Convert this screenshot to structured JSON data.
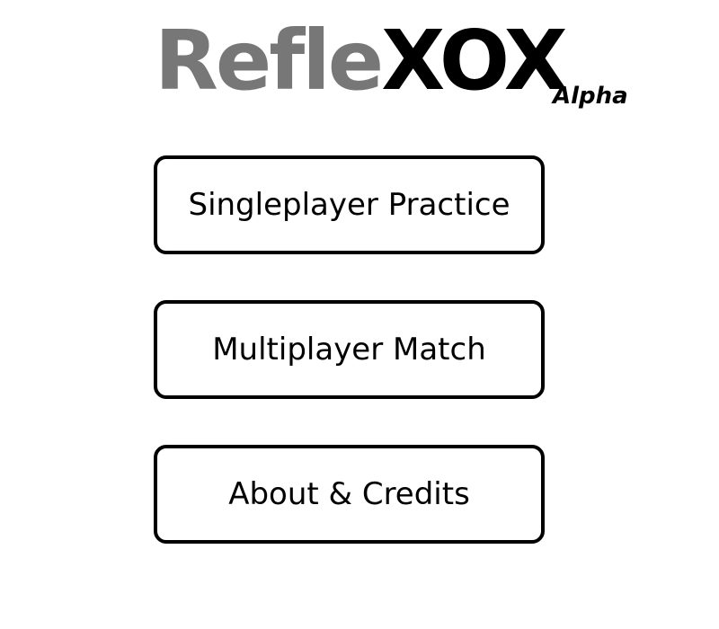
{
  "title": {
    "part1": "Refle",
    "part2": "XOX",
    "tag": "Alpha"
  },
  "menu": {
    "buttons": [
      {
        "label": "Singleplayer Practice"
      },
      {
        "label": "Multiplayer Match"
      },
      {
        "label": "About & Credits"
      }
    ]
  },
  "colors": {
    "title_part1": "#777777",
    "title_part2": "#000000",
    "button_border": "#000000",
    "background": "#ffffff"
  }
}
